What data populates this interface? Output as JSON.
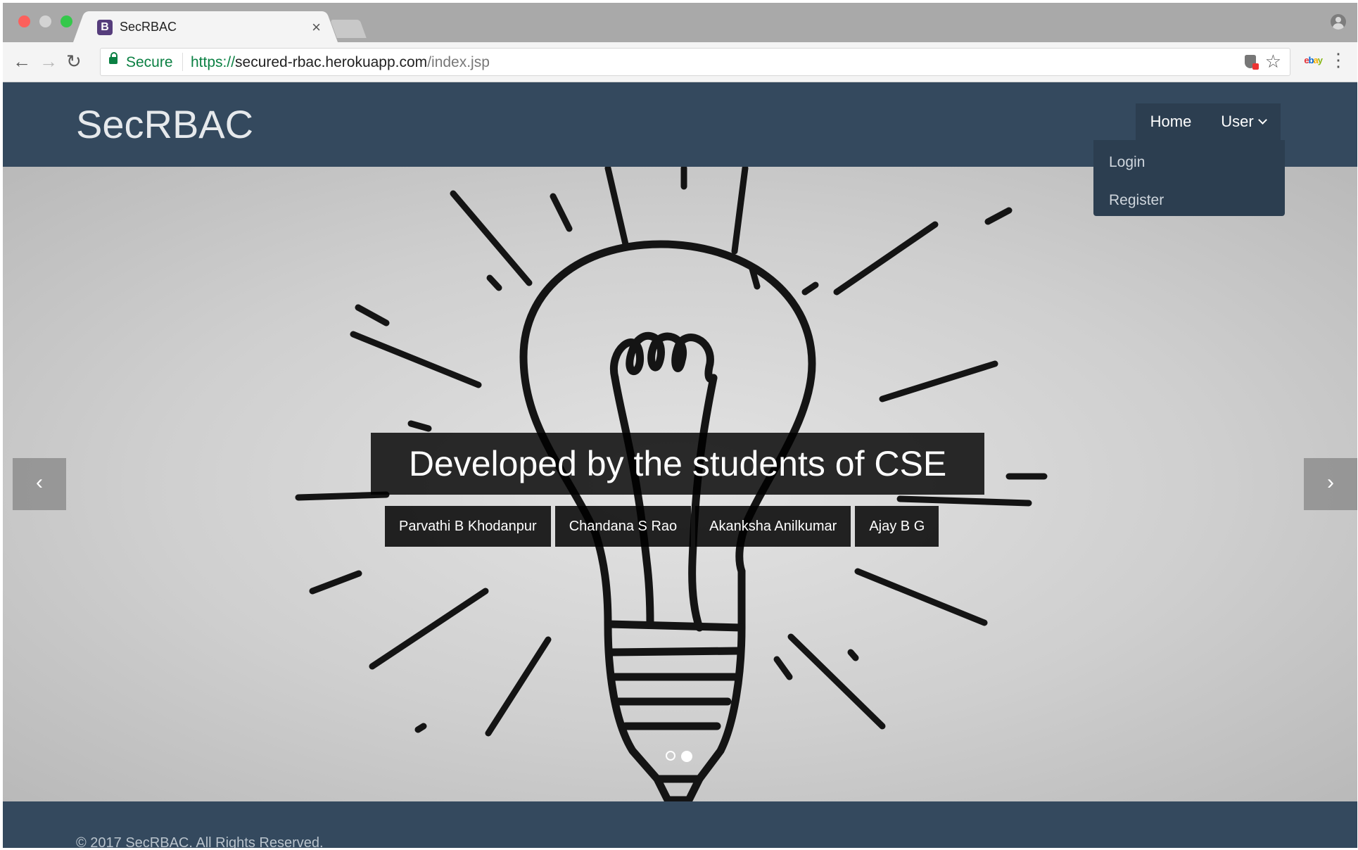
{
  "browser": {
    "tab": {
      "favicon": "B",
      "title": "SecRBAC",
      "close": "×"
    },
    "toolbar": {
      "back": "←",
      "forward": "→",
      "reload": "↻",
      "secure_label": "Secure",
      "url_scheme": "https://",
      "url_host": "secured-rbac.herokuapp.com",
      "url_path": "/index.jsp",
      "star": "☆",
      "menu": "⋮",
      "extension_letters": [
        "e",
        "b",
        "a",
        "y"
      ]
    }
  },
  "navbar": {
    "brand": "SecRBAC",
    "home_label": "Home",
    "user_label": "User",
    "dropdown": {
      "login": "Login",
      "register": "Register"
    }
  },
  "carousel": {
    "caption": "Developed by the students of CSE",
    "credits": [
      "Parvathi B Khodanpur",
      "Chandana S Rao",
      "Akanksha Anilkumar",
      "Ajay B G"
    ],
    "prev": "‹",
    "next": "›",
    "slide_count": 2,
    "active_slide": 2
  },
  "footer": {
    "copyright": "© 2017 SecRBAC. All Rights Reserved."
  }
}
